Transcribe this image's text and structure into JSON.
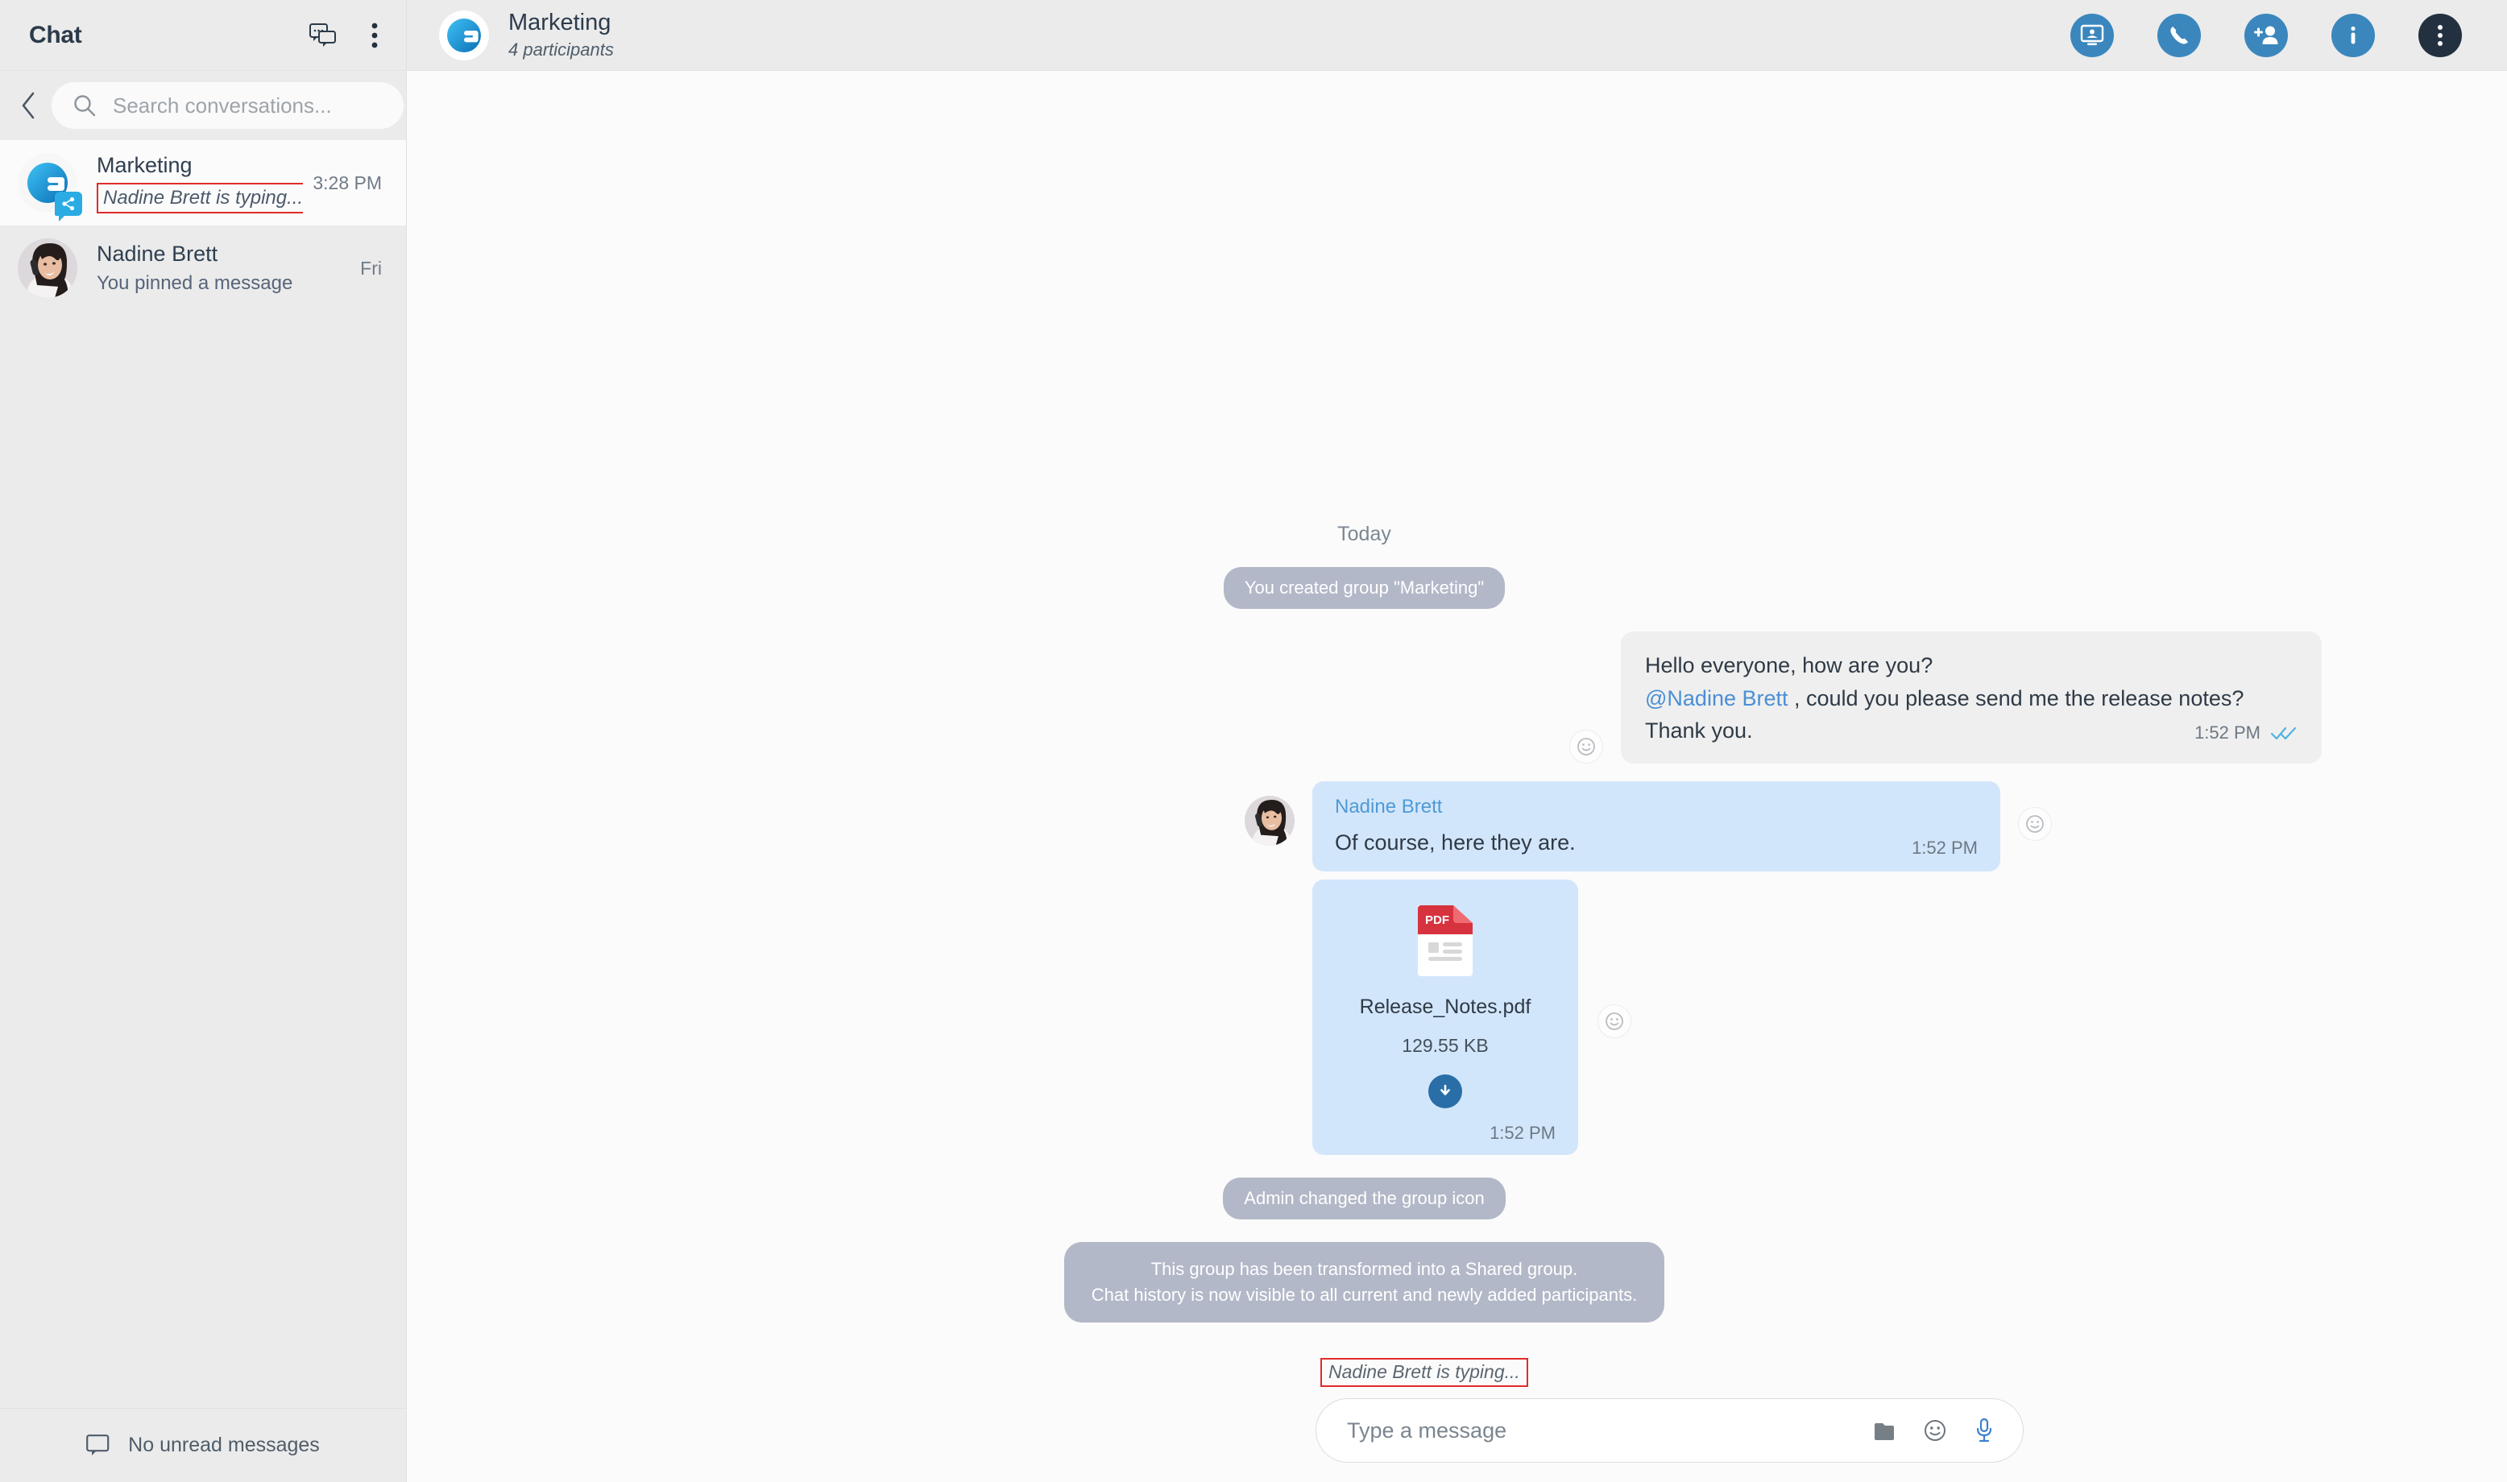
{
  "sidebar": {
    "title": "Chat",
    "header_icons": [
      {
        "name": "new-chat-icon",
        "label": "New chat"
      },
      {
        "name": "sidebar-more-options-icon",
        "label": "More options"
      }
    ],
    "back_icon": "chevron-left-icon",
    "search": {
      "placeholder": "Search conversations...",
      "value": "",
      "icon": "search-icon"
    },
    "conversations": [
      {
        "name": "Marketing",
        "preview": "Nadine Brett is typing...",
        "preview_is_typing": true,
        "time": "3:28 PM",
        "avatar_type": "group-logo",
        "badge_icon": "share-icon",
        "active": true
      },
      {
        "name": "Nadine Brett",
        "preview": "You pinned a message",
        "preview_is_typing": false,
        "time": "Fri",
        "avatar_type": "photo",
        "badge_icon": "",
        "active": false
      }
    ],
    "footer": {
      "icon": "chat-bubble-icon",
      "text": "No unread messages"
    }
  },
  "chat_header": {
    "title": "Marketing",
    "subtitle": "4 participants",
    "avatar_icon": "group-logo-icon",
    "actions": [
      {
        "name": "screen-share-button",
        "icon": "screen-share-icon",
        "style": "blue"
      },
      {
        "name": "call-button",
        "icon": "phone-icon",
        "style": "blue"
      },
      {
        "name": "add-participant-button",
        "icon": "person-add-icon",
        "style": "blue"
      },
      {
        "name": "info-button",
        "icon": "info-icon",
        "style": "blue"
      },
      {
        "name": "chat-more-options-button",
        "icon": "more-vertical-icon",
        "style": "dark"
      }
    ]
  },
  "conversation": {
    "day_separator": "Today",
    "system_created": "You created group \"Marketing\"",
    "outgoing": {
      "line1": "Hello everyone, how are you?",
      "mention": "@Nadine Brett",
      "line2_rest": " , could you please send me the release notes? Thank you.",
      "time": "1:52 PM",
      "status": "read",
      "react_icon": "emoji-reaction-icon"
    },
    "incoming": {
      "sender": "Nadine Brett",
      "text": "Of course, here they are.",
      "time": "1:52 PM",
      "react_icon": "emoji-reaction-icon"
    },
    "attachment": {
      "file_type": "PDF",
      "file_name": "Release_Notes.pdf",
      "file_size": "129.55 KB",
      "time": "1:52 PM",
      "download_icon": "download-icon",
      "react_icon": "emoji-reaction-icon"
    },
    "system_icon_changed": "Admin changed the group icon",
    "system_shared_group": {
      "line1": "This group has been transformed into a Shared group.",
      "line2": "Chat history is now visible to all current and newly added participants."
    }
  },
  "composer": {
    "typing_indicator": "Nadine Brett is typing...",
    "placeholder": "Type a message",
    "value": "",
    "icons": [
      {
        "name": "attach-file-icon",
        "label": "Attach file"
      },
      {
        "name": "emoji-picker-icon",
        "label": "Emoji"
      },
      {
        "name": "microphone-icon",
        "label": "Voice message"
      }
    ]
  },
  "colors": {
    "accent_blue": "#3b87bd",
    "mention_blue": "#4a8fd4",
    "incoming_bubble": "#d2e6fb",
    "outgoing_bubble": "#efefef",
    "system_bubble": "#b3b8c8",
    "sidebar_bg": "#ebebeb",
    "annotation_red": "#e02b2b"
  }
}
